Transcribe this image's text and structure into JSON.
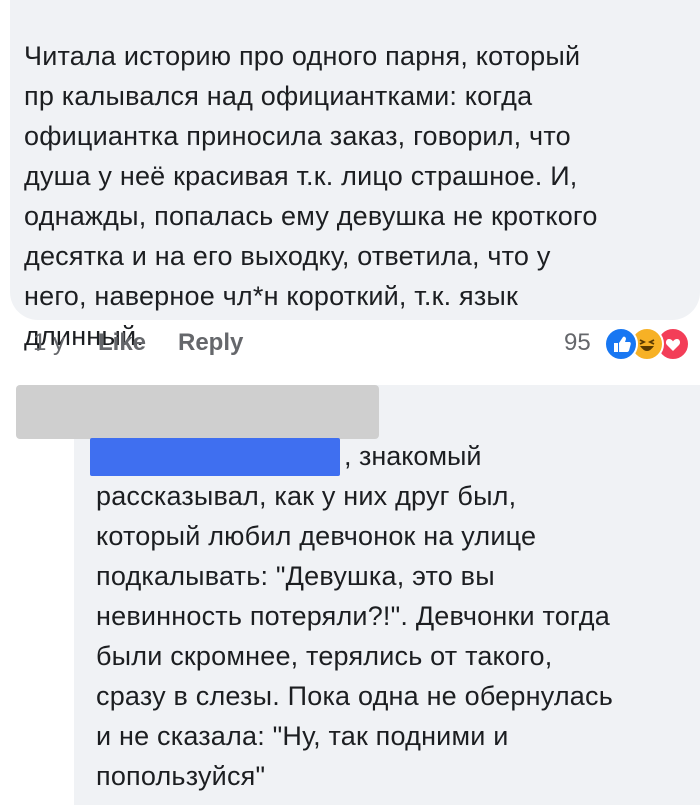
{
  "comment1": {
    "lines": [
      "Читала историю про одного парня, который",
      "пр калывался над официантками: когда",
      "официантка приносила заказ, говорил, что",
      "душа у неё красивая т.к. лицо страшное. И,",
      "однажды, попалась ему девушка не кроткого",
      "десятка и на его выходку, ответила, что у",
      "него, наверное чл*н короткий, т.к. язык",
      "длинный."
    ],
    "time": "1 y",
    "like_label": "Like",
    "reply_label": "Reply",
    "reaction_count": "95",
    "reactions": [
      "like-icon",
      "haha-icon",
      "love-icon"
    ]
  },
  "comment2": {
    "first_line_after_mention": ", знакомый",
    "lines": [
      "рассказывал, как у них друг был,",
      "который любил девчонок на улице",
      "подкалывать: \"Девушка, это вы",
      "невинность потеряли?!\". Девчонки тогда",
      "были скромнее, терялись от такого,",
      "сразу в слезы. Пока одна не обернулась",
      "и не сказала: \"Ну, так подними и",
      "попользуйся\""
    ]
  },
  "colors": {
    "bubble_bg": "#f0f2f5",
    "meta_text": "#65676b",
    "redaction_gray": "#cfcfcf",
    "redaction_blue": "#3f6ff0",
    "like_blue": "#1877f2",
    "haha_yellow": "#f7b125",
    "love_red": "#f33e58"
  }
}
